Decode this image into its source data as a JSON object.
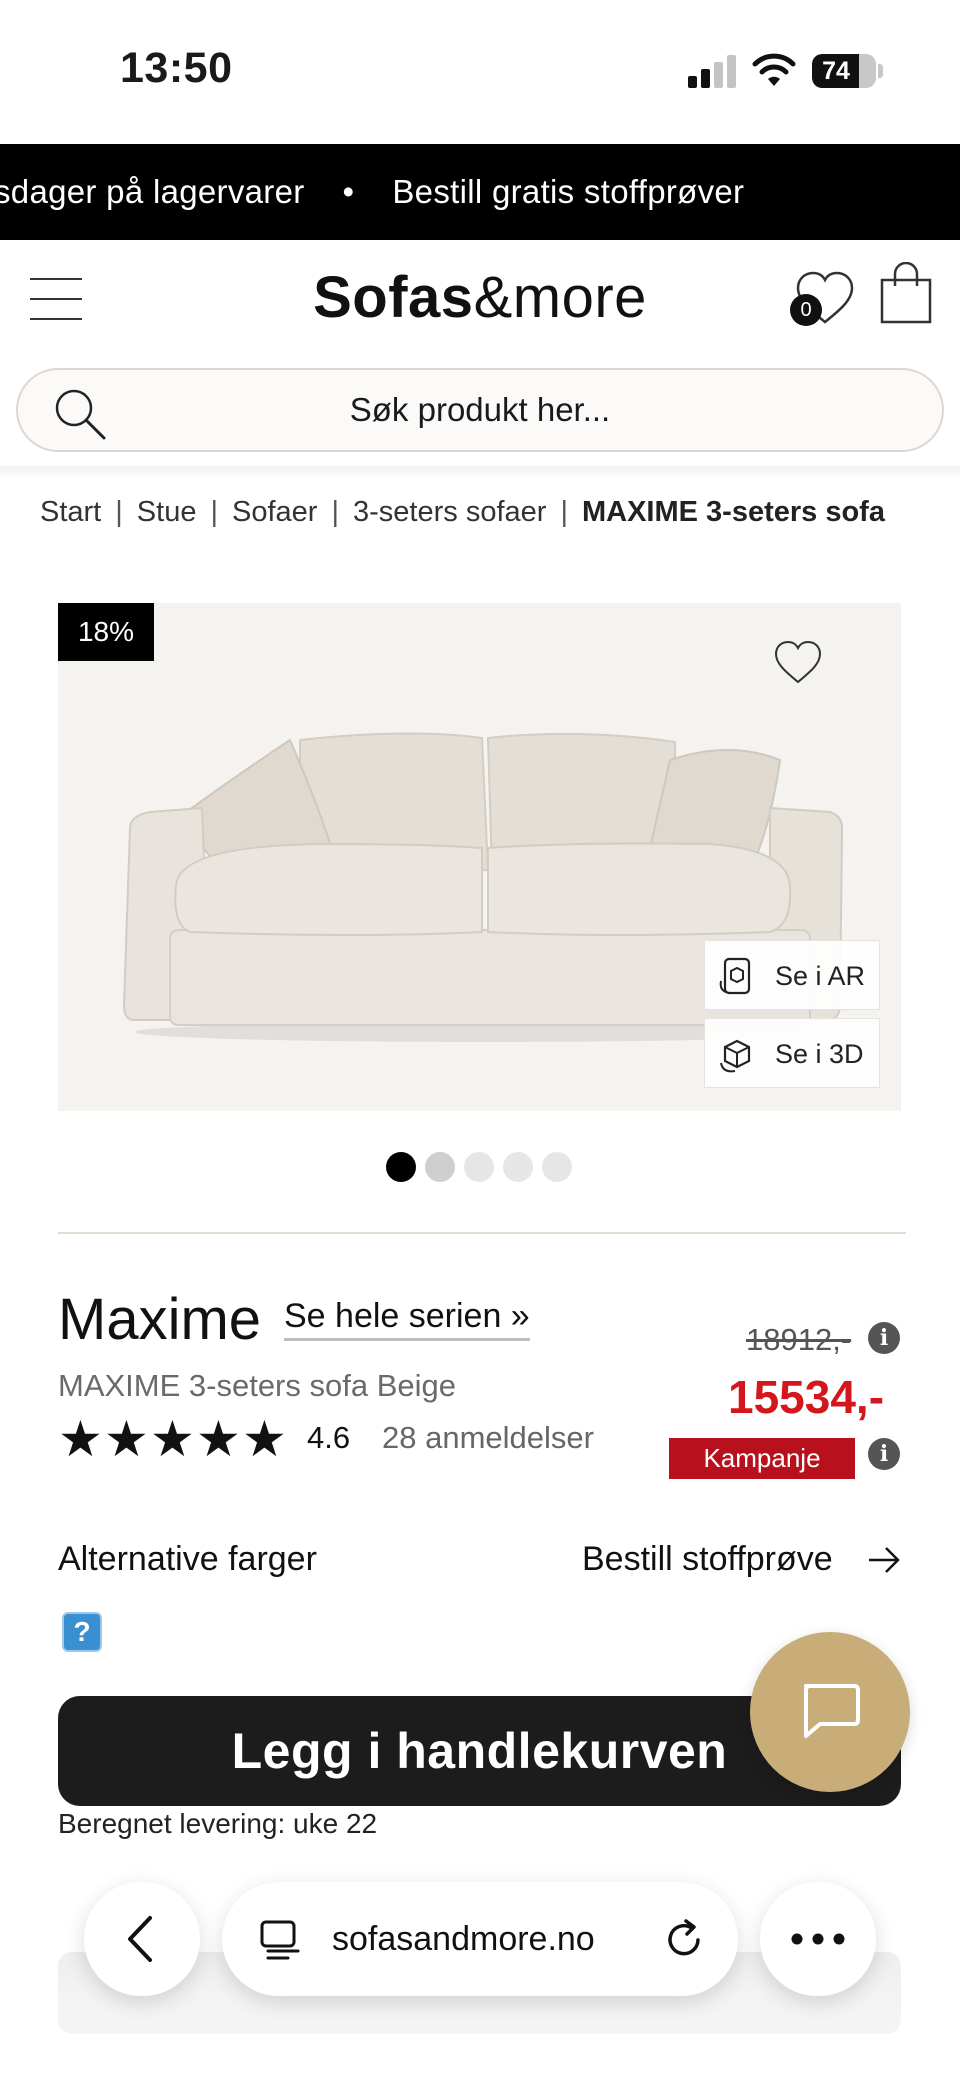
{
  "status_bar": {
    "time": "13:50",
    "battery": "74",
    "battery_level": 0.74
  },
  "banner": {
    "text_left": "sdager på lagervarer",
    "separator": "•",
    "text_right": "Bestill gratis stoffprøver"
  },
  "header": {
    "logo_bold": "Sofas",
    "logo_light": "&more",
    "wishlist_count": "0"
  },
  "search": {
    "placeholder": "Søk produkt her..."
  },
  "breadcrumb": {
    "items": [
      "Start",
      "Stue",
      "Sofaer",
      "3-seters sofaer"
    ],
    "current": "MAXIME 3-seters sofa",
    "separator": "|"
  },
  "product": {
    "discount": "18%",
    "view_ar": "Se i AR",
    "view_3d": "Se i 3D",
    "image_count": 5,
    "active_image": 1,
    "series_name": "Maxime",
    "series_link": "Se hele serien »",
    "subtitle": "MAXIME 3-seters sofa Beige",
    "old_price": "18912,-",
    "new_price": "15534,-",
    "campaign": "Kampanje",
    "rating": "4.6",
    "rating_value": 4.6,
    "reviews": "28 anmeldelser",
    "alt_colors": "Alternative farger",
    "fabric_sample": "Bestill stoffprøve",
    "add_to_cart": "Legg i handlekurven",
    "delivery_label": "Beregnet levering:",
    "delivery_value": "uke 22"
  },
  "colors": {
    "price_red": "#d4161d",
    "campaign_red": "#b8111d",
    "chat_gold": "#c8ad78",
    "button_dark": "#1c1c1c"
  },
  "browser": {
    "url": "sofasandmore.no"
  }
}
